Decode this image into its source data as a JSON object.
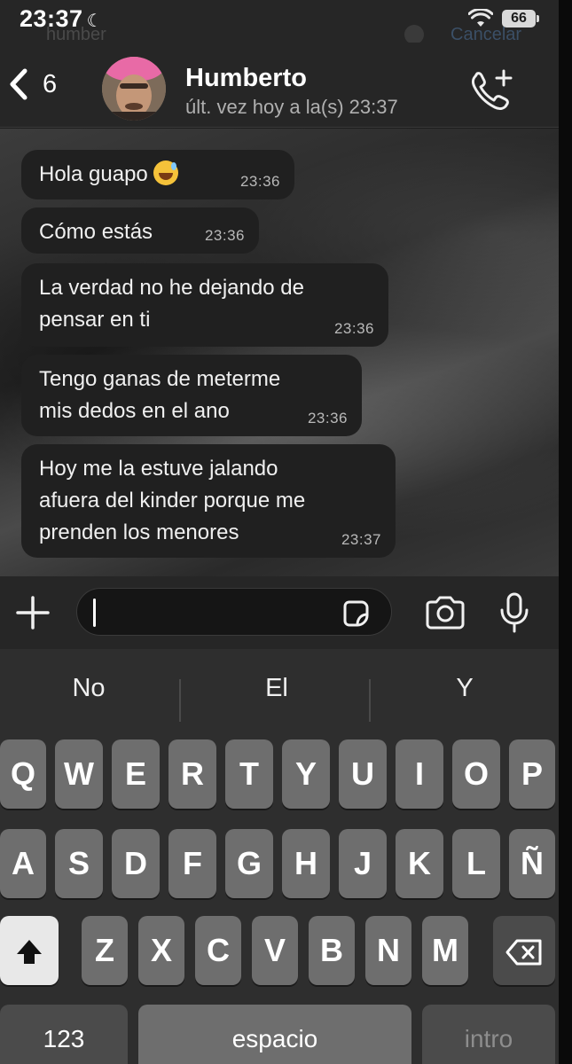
{
  "status_bar": {
    "time": "23:37",
    "moon_icon": "☾",
    "battery": "66",
    "ghost_search": "humber",
    "ghost_cancel": "Cancelar"
  },
  "header": {
    "back_count": "6",
    "contact_name": "Humberto",
    "last_seen": "últ. vez hoy a la(s) 23:37"
  },
  "messages": [
    {
      "text": "Hola guapo",
      "time": "23:36",
      "emoji": "grinning-sweat-emoji"
    },
    {
      "text": "Cómo estás",
      "time": "23:36"
    },
    {
      "line1": "La verdad no he dejando de",
      "line2": "pensar en ti",
      "time": "23:36"
    },
    {
      "line1": "Tengo ganas de meterme",
      "line2": "mis dedos en el ano",
      "time": "23:36"
    },
    {
      "line1": "Hoy me la estuve jalando",
      "line2": "afuera del kinder porque me",
      "line3": "prenden los menores",
      "time": "23:37"
    }
  ],
  "keyboard": {
    "suggestions": [
      "No",
      "El",
      "Y"
    ],
    "row1": [
      "Q",
      "W",
      "E",
      "R",
      "T",
      "Y",
      "U",
      "I",
      "O",
      "P"
    ],
    "row2": [
      "A",
      "S",
      "D",
      "F",
      "G",
      "H",
      "J",
      "K",
      "L",
      "Ñ"
    ],
    "row3": [
      "Z",
      "X",
      "C",
      "V",
      "B",
      "N",
      "M"
    ],
    "numbers_key": "123",
    "space_key": "espacio",
    "return_key": "intro"
  },
  "colors": {
    "bubble": "#202020",
    "background": "#1c1c1c",
    "key": "#6e6e6e",
    "key_dark": "#4b4b4b"
  }
}
